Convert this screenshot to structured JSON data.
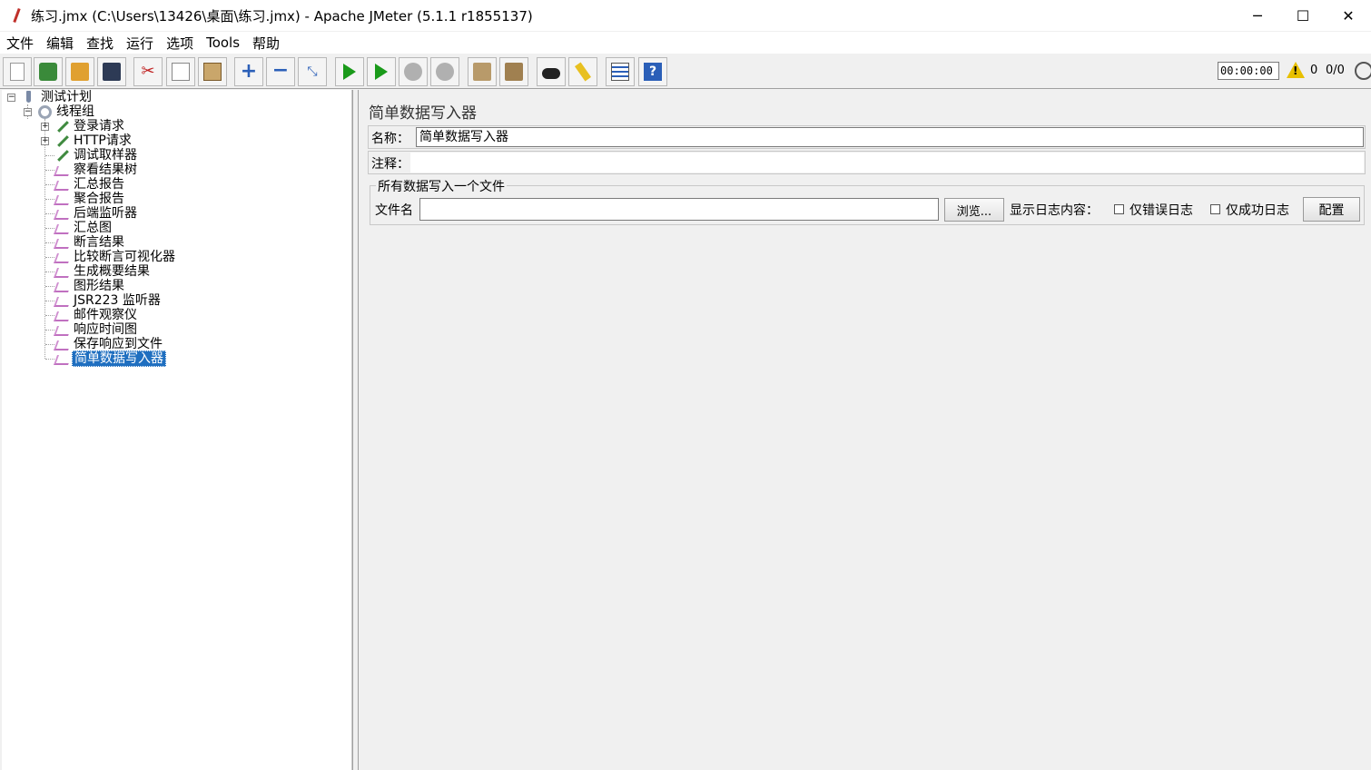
{
  "window": {
    "title": "练习.jmx (C:\\Users\\13426\\桌面\\练习.jmx) - Apache JMeter (5.1.1 r1855137)"
  },
  "menu": [
    "文件",
    "编辑",
    "查找",
    "运行",
    "选项",
    "Tools",
    "帮助"
  ],
  "toolbar": {
    "icons": [
      "new-icon",
      "templates-icon",
      "open-icon",
      "save-icon",
      "cut-icon",
      "copy-icon",
      "paste-icon",
      "expand-icon",
      "collapse-icon",
      "toggle-icon",
      "start-icon",
      "start-no-pause-icon",
      "stop-icon",
      "shutdown-icon",
      "clear-icon",
      "clear-all-icon",
      "search-icon",
      "reset-search-icon",
      "function-helper-icon",
      "help-icon"
    ],
    "timer": "00:00:00",
    "warn_count": "0",
    "threads": "0/0"
  },
  "tree": {
    "root": "测试计划",
    "thread_group": "线程组",
    "children": [
      "登录请求",
      "HTTP请求",
      "调试取样器",
      "察看结果树",
      "汇总报告",
      "聚合报告",
      "后端监听器",
      "汇总图",
      "断言结果",
      "比较断言可视化器",
      "生成概要结果",
      "图形结果",
      "JSR223 监听器",
      "邮件观察仪",
      "响应时间图",
      "保存响应到文件",
      "简单数据写入器"
    ]
  },
  "panel": {
    "title": "简单数据写入器",
    "name_label": "名称：",
    "name_value": "简单数据写入器",
    "comment_label": "注释：",
    "group_title": "所有数据写入一个文件",
    "filename_label": "文件名",
    "browse_label": "浏览...",
    "log_label": "显示日志内容：",
    "errors_only_label": "仅错误日志",
    "success_only_label": "仅成功日志",
    "configure_label": "配置"
  },
  "colors": {
    "selection": "#1f6fc0"
  }
}
